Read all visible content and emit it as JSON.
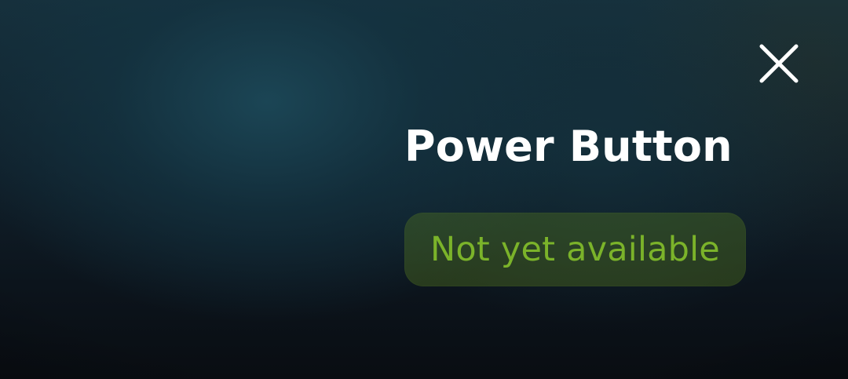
{
  "dialog": {
    "title": "Power Button",
    "status": {
      "label": "Not yet available"
    },
    "close": {
      "icon": "close-icon"
    }
  },
  "colors": {
    "background_top": "#16303c",
    "background_bottom": "#090d12",
    "title_text": "#ffffff",
    "status_text": "#7bb32a",
    "status_pill": "#3f5420"
  }
}
